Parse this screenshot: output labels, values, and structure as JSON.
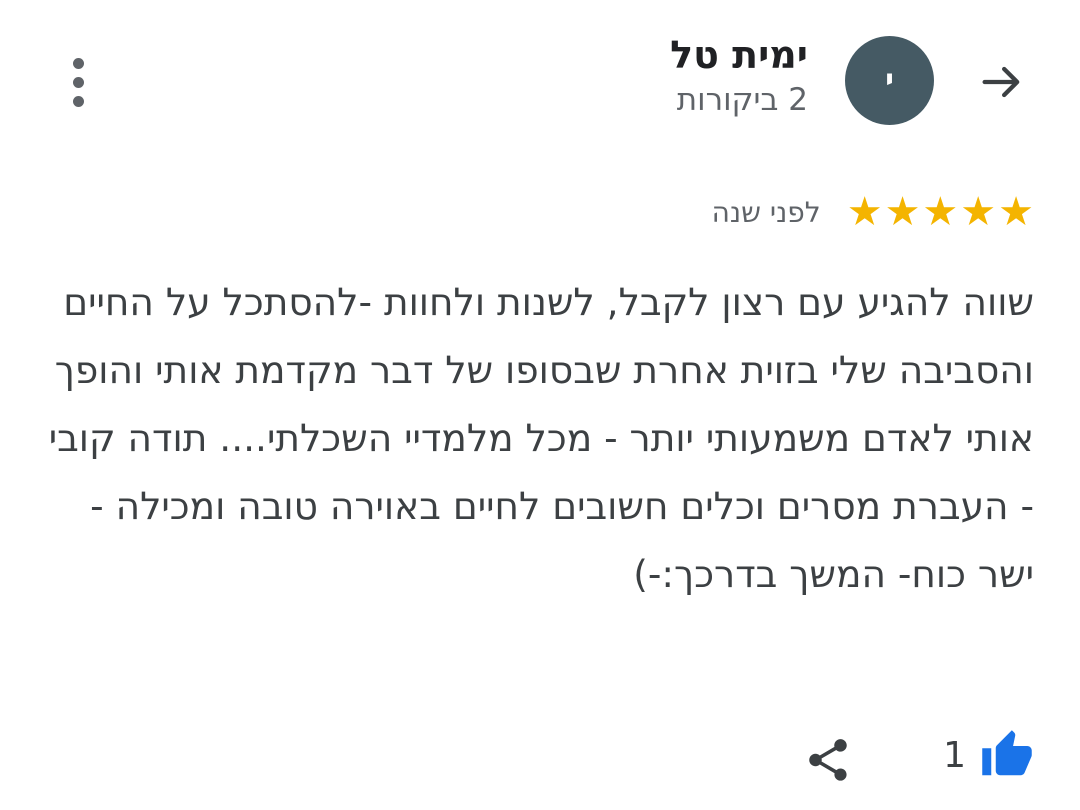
{
  "header": {
    "back_icon": "arrow-right-icon",
    "avatar_initial": "י",
    "avatar_color": "#455a64",
    "reviewer_name": "ימית טל",
    "reviewer_reviews": "2 ביקורות",
    "menu_icon": "more-vertical-icon"
  },
  "review": {
    "rating": 5,
    "max_rating": 5,
    "star_color": "#f4b400",
    "stars": [
      "★",
      "★",
      "★",
      "★",
      "★"
    ],
    "date": "לפני שנה",
    "text": "שווה להגיע עם רצון לקבל, לשנות ולחוות -להסתכל על החיים והסביבה שלי בזוית אחרת שבסופו של דבר מקדמת אותי והופך אותי לאדם משמעותי יותר - מכל מלמדיי השכלתי.... תודה קובי - העברת מסרים וכלים חשובים לחיים באוירה טובה ומכילה - ישר כוח- המשך בדרכך:-)"
  },
  "actions": {
    "like_icon": "thumbs-up-icon",
    "like_color": "#1a73e8",
    "like_count": "1",
    "share_icon": "share-icon"
  }
}
